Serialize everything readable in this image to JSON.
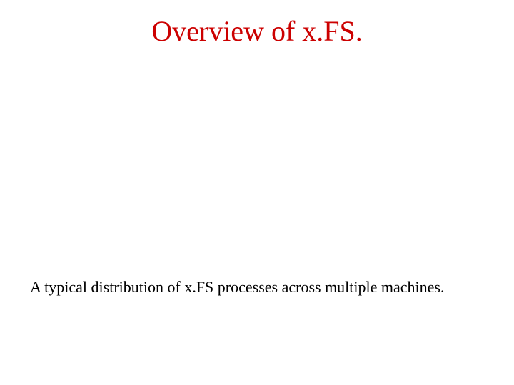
{
  "title": "Overview of x.FS.",
  "caption": "A typical distribution of x.FS processes across multiple machines."
}
